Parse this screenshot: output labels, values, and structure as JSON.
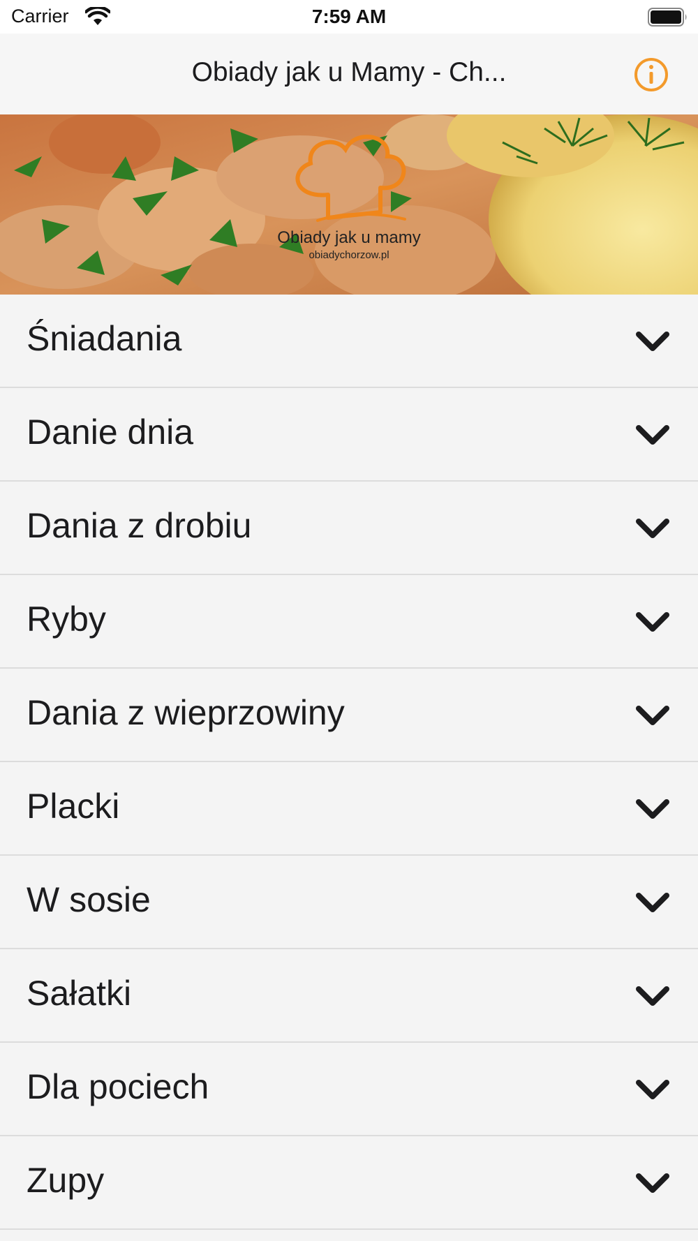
{
  "status_bar": {
    "carrier": "Carrier",
    "time": "7:59 AM",
    "wifi_icon": "wifi-icon",
    "battery_icon": "battery-icon"
  },
  "nav_bar": {
    "title": "Obiady jak u Mamy - Ch...",
    "info_icon": "info-icon",
    "accent_color": "#f39a2b"
  },
  "banner": {
    "logo_line1": "Obiady jak u mamy",
    "logo_line2": "obiadychorzow.pl",
    "logo_icon": "chef-hat-icon"
  },
  "categories": [
    {
      "label": "Śniadania"
    },
    {
      "label": "Danie dnia"
    },
    {
      "label": "Dania z drobiu"
    },
    {
      "label": "Ryby"
    },
    {
      "label": "Dania z wieprzowiny"
    },
    {
      "label": "Placki"
    },
    {
      "label": "W sosie"
    },
    {
      "label": "Sałatki"
    },
    {
      "label": "Dla pociech"
    },
    {
      "label": "Zupy"
    }
  ],
  "row_icon": "chevron-down-icon"
}
